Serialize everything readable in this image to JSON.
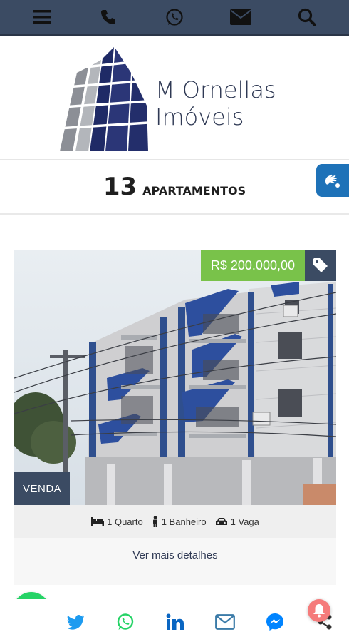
{
  "topbar": {
    "icons": [
      "menu-icon",
      "phone-icon",
      "whatsapp-icon",
      "mail-icon",
      "search-icon"
    ],
    "bg_color": "#3b4b63"
  },
  "brand": {
    "line1": "M Ornellas",
    "line2": "Imóveis",
    "color": "#2f3954"
  },
  "listing_header": {
    "count": "13",
    "label": "APARTAMENTOS"
  },
  "card": {
    "price": "R$ 200.000,00",
    "price_color": "#79c24a",
    "type_badge": "VENDA",
    "features": [
      {
        "icon": "bed-icon",
        "label": "1 Quarto"
      },
      {
        "icon": "person-icon",
        "label": "1 Banheiro"
      },
      {
        "icon": "car-icon",
        "label": "1 Vaga"
      }
    ],
    "details_link": "Ver mais detalhes"
  },
  "share": {
    "icons": [
      "twitter-icon",
      "whatsapp-icon",
      "linkedin-icon",
      "mail-icon",
      "messenger-icon",
      "share-icon"
    ]
  }
}
